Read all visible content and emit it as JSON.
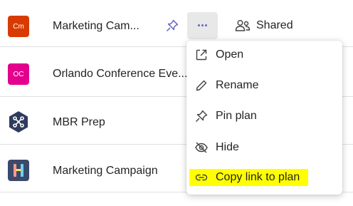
{
  "plans": [
    {
      "initials": "Cm",
      "color": "#d83b01",
      "name": "Marketing Cam..."
    },
    {
      "initials": "OC",
      "color": "#e3008c",
      "name": "Orlando Conference Eve..."
    },
    {
      "initials": "",
      "color": "#2f3b5c",
      "name": "MBR Prep",
      "icon": "network-icon"
    },
    {
      "initials": "",
      "color": "#3b4a6b",
      "name": "Marketing Campaign",
      "icon": "people-icon"
    }
  ],
  "row1": {
    "shared_label": "Shared",
    "more_label": "···"
  },
  "menu": {
    "items": [
      {
        "label": "Open",
        "icon": "open-external-icon"
      },
      {
        "label": "Rename",
        "icon": "pencil-icon"
      },
      {
        "label": "Pin plan",
        "icon": "pin-icon"
      },
      {
        "label": "Hide",
        "icon": "eye-off-icon"
      },
      {
        "label": "Copy link to plan",
        "icon": "link-icon",
        "highlight_color": "#ffff00"
      }
    ]
  },
  "colors": {
    "accent": "#5b5fc7",
    "hover": "#e8e8e8"
  }
}
